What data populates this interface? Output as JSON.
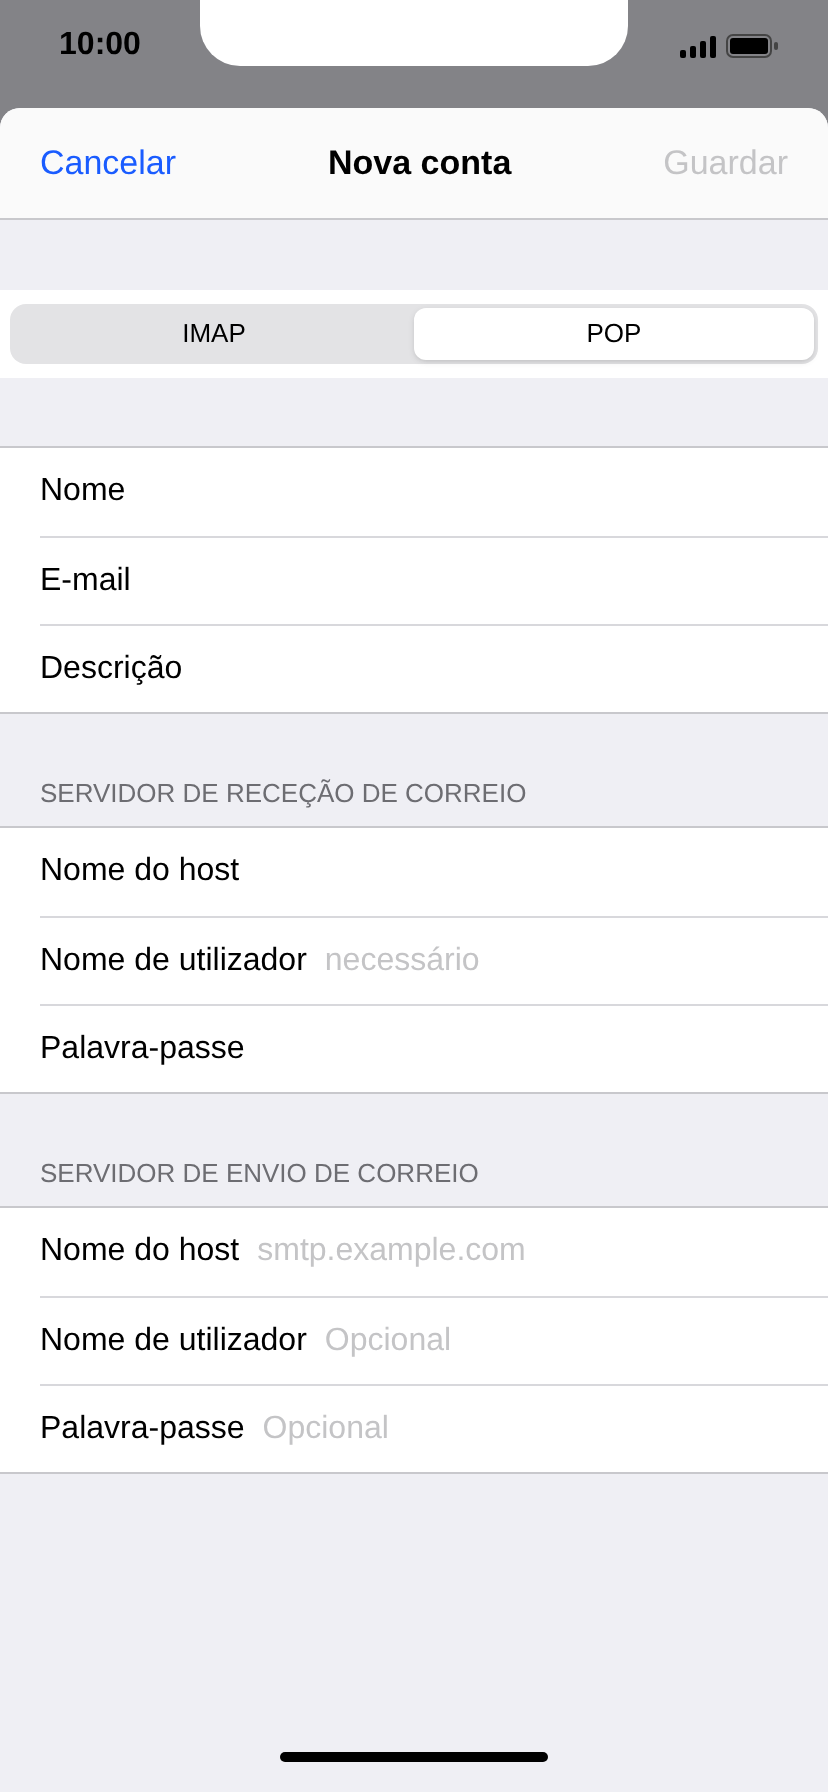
{
  "status_bar": {
    "time": "10:00"
  },
  "nav": {
    "cancel": "Cancelar",
    "title": "Nova conta",
    "save": {
      "label": "Guardar",
      "disabled": true
    }
  },
  "segments": [
    {
      "label": "IMAP",
      "selected": false
    },
    {
      "label": "POP",
      "selected": true
    }
  ],
  "sections": [
    {
      "fields": [
        {
          "label": "Nome"
        },
        {
          "label": "E-mail"
        },
        {
          "label": "Descrição"
        }
      ]
    },
    {
      "header": "SERVIDOR DE RECEÇÃO DE CORREIO",
      "fields": [
        {
          "label": "Nome do host"
        },
        {
          "label": "Nome de utilizador",
          "placeholder": "necessário"
        },
        {
          "label": "Palavra-passe"
        }
      ]
    },
    {
      "header": "SERVIDOR DE ENVIO DE CORREIO",
      "fields": [
        {
          "label": "Nome do host",
          "placeholder": "smtp.example.com"
        },
        {
          "label": "Nome de utilizador",
          "placeholder": "Opcional"
        },
        {
          "label": "Palavra-passe",
          "placeholder": "Opcional"
        }
      ]
    }
  ]
}
